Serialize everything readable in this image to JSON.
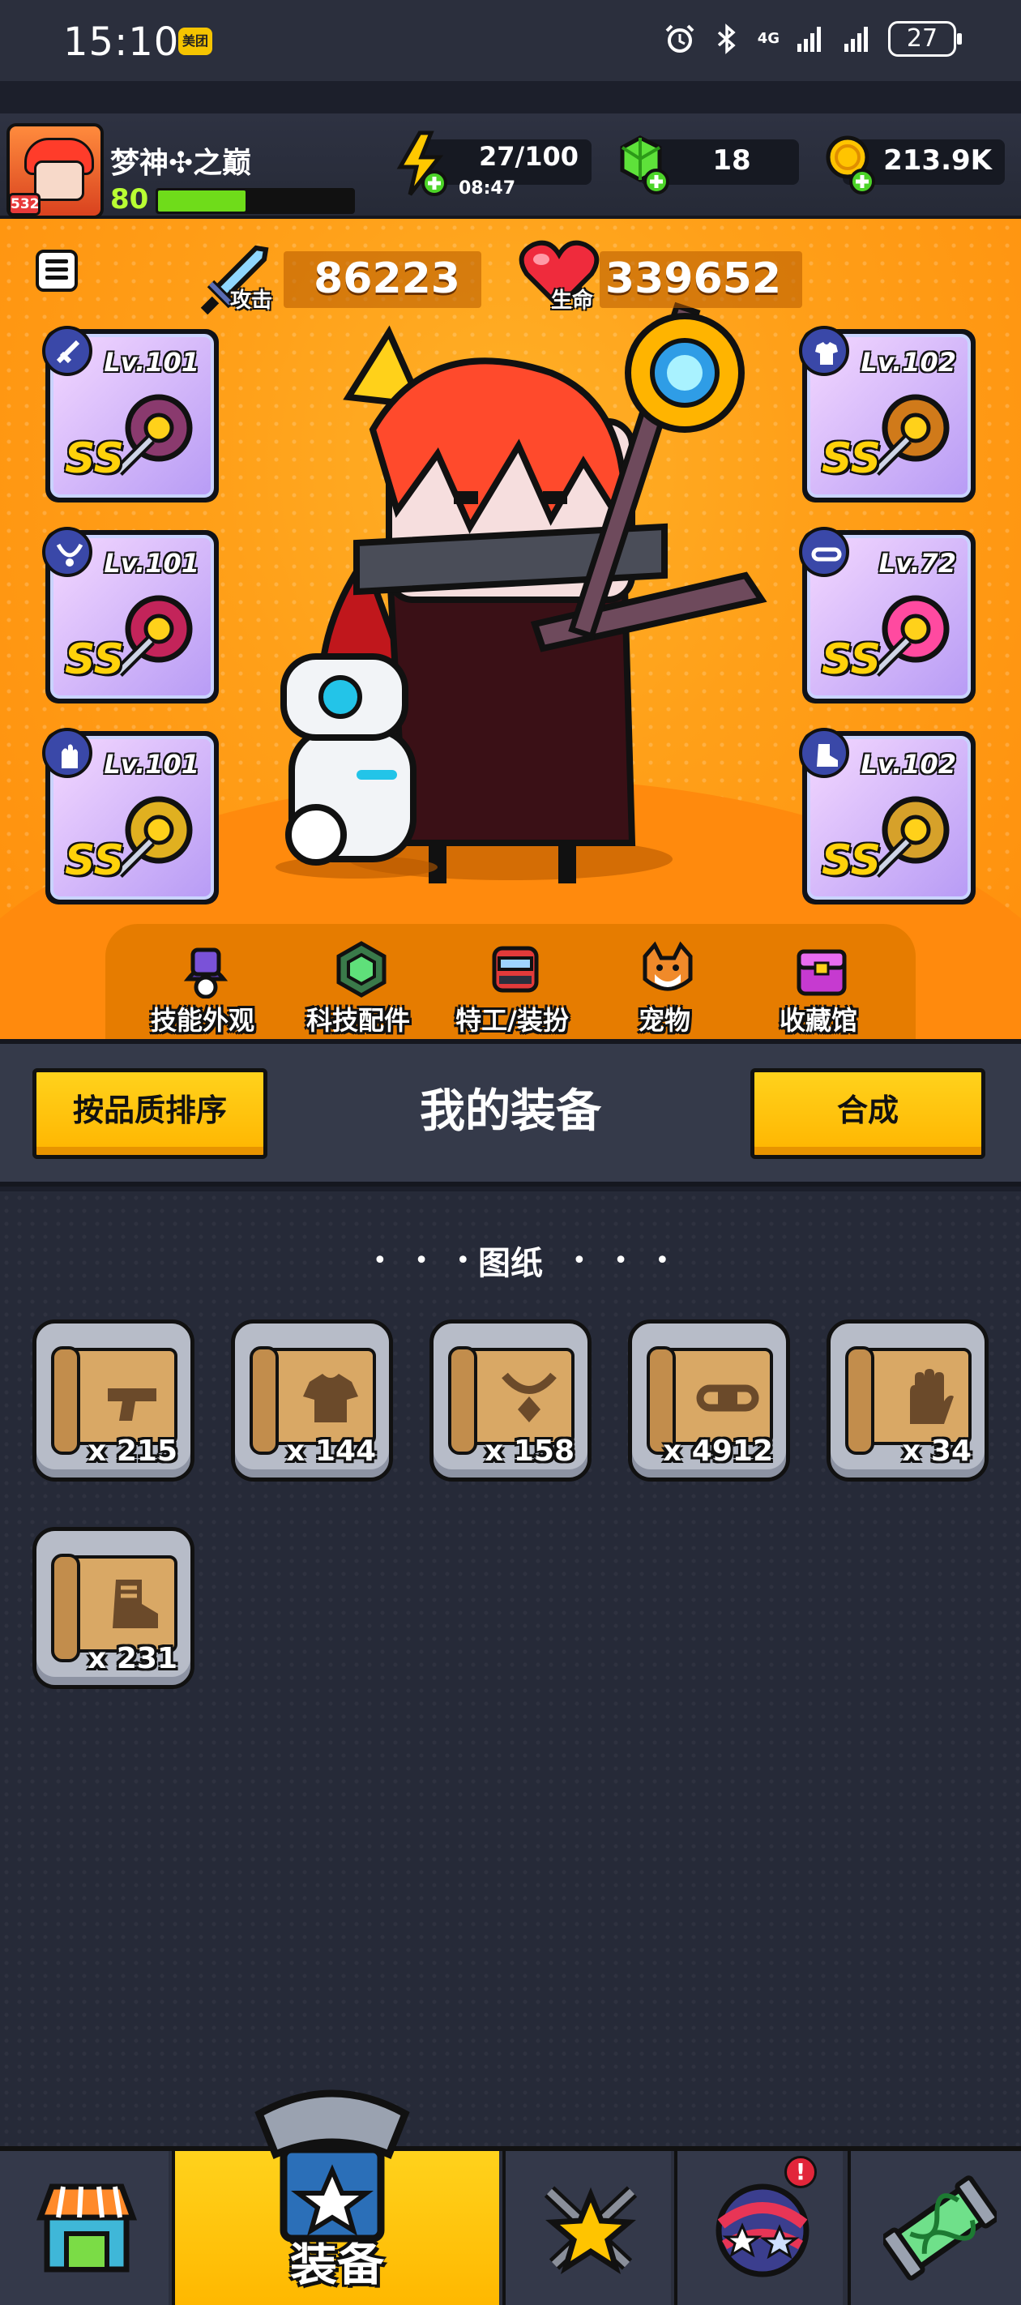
{
  "status_bar": {
    "time": "15:10",
    "app_badge": "美团",
    "network": "4G",
    "battery": "27"
  },
  "player": {
    "name": "梦神✣之巅",
    "level": "80",
    "avatar_badge": "532",
    "xp_fraction": 0.45
  },
  "resources": {
    "energy": "27/100",
    "energy_timer": "08:47",
    "gems": "18",
    "coins": "213.9K"
  },
  "stats": {
    "attack_label": "攻击",
    "attack_value": "86223",
    "hp_label": "生命",
    "hp_value": "339652"
  },
  "equipment": {
    "left": [
      {
        "slot": "weapon-icon",
        "level": "Lv.101",
        "rank": "SS"
      },
      {
        "slot": "necklace-icon",
        "level": "Lv.101",
        "rank": "SS"
      },
      {
        "slot": "glove-icon",
        "level": "Lv.101",
        "rank": "SS"
      }
    ],
    "right": [
      {
        "slot": "armor-icon",
        "level": "Lv.102",
        "rank": "SS"
      },
      {
        "slot": "belt-icon",
        "level": "Lv.72",
        "rank": "SS"
      },
      {
        "slot": "boots-icon",
        "level": "Lv.102",
        "rank": "SS"
      }
    ]
  },
  "shortcuts": [
    {
      "label": "技能外观",
      "icon": "skin-hat-icon"
    },
    {
      "label": "科技配件",
      "icon": "tech-part-icon"
    },
    {
      "label": "特工/装扮",
      "icon": "agent-icon"
    },
    {
      "label": "宠物",
      "icon": "pet-dog-icon"
    },
    {
      "label": "收藏馆",
      "icon": "collection-chest-icon"
    }
  ],
  "toolbar": {
    "sort_button": "按品质排序",
    "title": "我的装备",
    "merge_button": "合成"
  },
  "blueprints": {
    "title": "图纸",
    "dots_left": "• • •",
    "dots_right": "• • •",
    "items": [
      {
        "type": "weapon-icon",
        "qty": "x 215"
      },
      {
        "type": "armor-icon",
        "qty": "x 144"
      },
      {
        "type": "necklace-icon",
        "qty": "x 158"
      },
      {
        "type": "belt-icon",
        "qty": "x 4912"
      },
      {
        "type": "glove-icon",
        "qty": "x 34"
      },
      {
        "type": "boots-icon",
        "qty": "x 231"
      }
    ]
  },
  "bottom_nav": {
    "tabs": [
      "shop-icon",
      "equipment-icon",
      "battle-icon",
      "planet-icon",
      "evolve-icon"
    ],
    "active_label": "装备",
    "notification": "!"
  },
  "colors": {
    "hero_bg": "#ffa019",
    "accent_yellow": "#ffc40d",
    "panel": "#353a4a"
  }
}
